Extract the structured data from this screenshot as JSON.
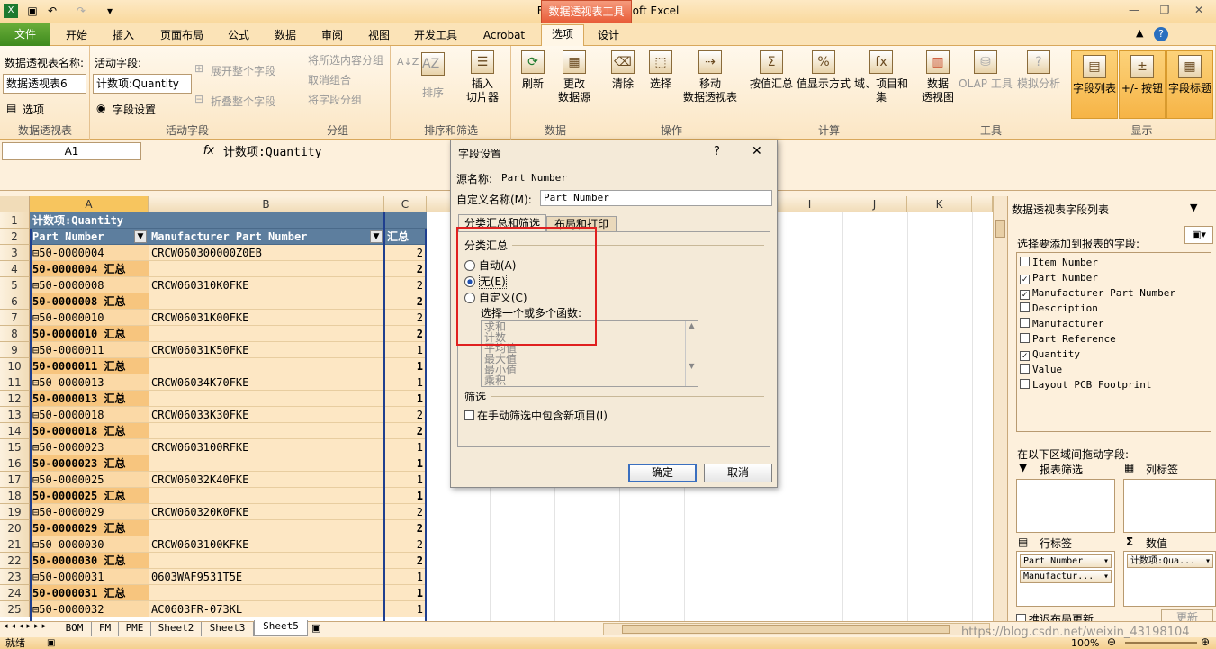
{
  "window": {
    "title": "BOM.xlsx - Microsoft Excel",
    "context_tool": "数据透视表工具"
  },
  "tabs": [
    "文件",
    "开始",
    "插入",
    "页面布局",
    "公式",
    "数据",
    "审阅",
    "视图",
    "开发工具",
    "Acrobat",
    "选项",
    "设计"
  ],
  "ribbon": {
    "pt_name_label": "数据透视表名称:",
    "pt_name_value": "数据透视表6",
    "options_btn": "选项",
    "grp_pt": "数据透视表",
    "active_field_label": "活动字段:",
    "active_field_value": "计数项:Quantity",
    "field_settings": "字段设置",
    "expand_all": "展开整个字段",
    "collapse_all": "折叠整个字段",
    "grp_active": "活动字段",
    "group_sel": "将所选内容分组",
    "ungroup": "取消组合",
    "group_field": "将字段分组",
    "grp_group": "分组",
    "sort": "排序",
    "insert_slicer": "插入\n切片器",
    "grp_sort": "排序和筛选",
    "refresh": "刷新",
    "change_source": "更改\n数据源",
    "grp_data": "数据",
    "clear": "清除",
    "select": "选择",
    "move_pt": "移动\n数据透视表",
    "grp_actions": "操作",
    "summarize_by": "按值汇总",
    "show_values_as": "值显示方式",
    "fields_items": "域、项目和\n集",
    "grp_calc": "计算",
    "pivot_chart": "数据\n透视图",
    "olap": "OLAP 工具",
    "what_if": "模拟分析",
    "grp_tools": "工具",
    "field_list": "字段列表",
    "plus_minus": "+/- 按钮",
    "field_headers": "字段标题",
    "grp_show": "显示"
  },
  "formula_bar": {
    "name_box": "A1",
    "fx": "fx",
    "formula": "计数项:Quantity"
  },
  "columns": [
    "A",
    "B",
    "C",
    "D",
    "E",
    "F",
    "G",
    "H",
    "I",
    "J",
    "K"
  ],
  "rows": [
    {
      "n": "1",
      "a": "计数项:Quantity",
      "b": "",
      "c": "",
      "style": "title"
    },
    {
      "n": "2",
      "a": "Part Number",
      "b": "Manufacturer Part Number",
      "c": "汇总",
      "style": "header"
    },
    {
      "n": "3",
      "a": "⊟50-0000004",
      "b": "CRCW060300000Z0EB",
      "c": "2",
      "style": "item"
    },
    {
      "n": "4",
      "a": "50-0000004 汇总",
      "b": "",
      "c": "2",
      "style": "total"
    },
    {
      "n": "5",
      "a": "⊟50-0000008",
      "b": "CRCW060310K0FKE",
      "c": "2",
      "style": "item"
    },
    {
      "n": "6",
      "a": "50-0000008 汇总",
      "b": "",
      "c": "2",
      "style": "total"
    },
    {
      "n": "7",
      "a": "⊟50-0000010",
      "b": "CRCW06031K00FKE",
      "c": "2",
      "style": "item"
    },
    {
      "n": "8",
      "a": "50-0000010 汇总",
      "b": "",
      "c": "2",
      "style": "total"
    },
    {
      "n": "9",
      "a": "⊟50-0000011",
      "b": "CRCW06031K50FKE",
      "c": "1",
      "style": "item"
    },
    {
      "n": "10",
      "a": "50-0000011 汇总",
      "b": "",
      "c": "1",
      "style": "total"
    },
    {
      "n": "11",
      "a": "⊟50-0000013",
      "b": "CRCW06034K70FKE",
      "c": "1",
      "style": "item"
    },
    {
      "n": "12",
      "a": "50-0000013 汇总",
      "b": "",
      "c": "1",
      "style": "total"
    },
    {
      "n": "13",
      "a": "⊟50-0000018",
      "b": "CRCW06033K30FKE",
      "c": "2",
      "style": "item"
    },
    {
      "n": "14",
      "a": "50-0000018 汇总",
      "b": "",
      "c": "2",
      "style": "total"
    },
    {
      "n": "15",
      "a": "⊟50-0000023",
      "b": "CRCW0603100RFKE",
      "c": "1",
      "style": "item"
    },
    {
      "n": "16",
      "a": "50-0000023 汇总",
      "b": "",
      "c": "1",
      "style": "total"
    },
    {
      "n": "17",
      "a": "⊟50-0000025",
      "b": "CRCW06032K40FKE",
      "c": "1",
      "style": "item"
    },
    {
      "n": "18",
      "a": "50-0000025 汇总",
      "b": "",
      "c": "1",
      "style": "total"
    },
    {
      "n": "19",
      "a": "⊟50-0000029",
      "b": "CRCW060320K0FKE",
      "c": "2",
      "style": "item"
    },
    {
      "n": "20",
      "a": "50-0000029 汇总",
      "b": "",
      "c": "2",
      "style": "total"
    },
    {
      "n": "21",
      "a": "⊟50-0000030",
      "b": "CRCW0603100KFKE",
      "c": "2",
      "style": "item"
    },
    {
      "n": "22",
      "a": "50-0000030 汇总",
      "b": "",
      "c": "2",
      "style": "total"
    },
    {
      "n": "23",
      "a": "⊟50-0000031",
      "b": "0603WAF9531T5E",
      "c": "1",
      "style": "item"
    },
    {
      "n": "24",
      "a": "50-0000031 汇总",
      "b": "",
      "c": "1",
      "style": "total"
    },
    {
      "n": "25",
      "a": "⊟50-0000032",
      "b": "AC0603FR-073KL",
      "c": "1",
      "style": "item"
    }
  ],
  "dialog": {
    "title": "字段设置",
    "help": "?",
    "close": "✕",
    "source_label": "源名称:",
    "source_value": "Part Number",
    "custom_label": "自定义名称(M):",
    "custom_value": "Part Number",
    "tab1": "分类汇总和筛选",
    "tab2": "布局和打印",
    "subtotals": "分类汇总",
    "auto": "自动(A)",
    "none": "无(E)",
    "custom": "自定义(C)",
    "choose_funcs": "选择一个或多个函数:",
    "funcs": [
      "求和",
      "计数",
      "平均值",
      "最大值",
      "最小值",
      "乘积"
    ],
    "filter": "筛选",
    "include_new": "在手动筛选中包含新项目(I)",
    "ok": "确定",
    "cancel": "取消"
  },
  "pane": {
    "title": "数据透视表字段列表",
    "choose": "选择要添加到报表的字段:",
    "fields": [
      {
        "name": "Item Number",
        "checked": false
      },
      {
        "name": "Part Number",
        "checked": true
      },
      {
        "name": "Manufacturer Part Number",
        "checked": true
      },
      {
        "name": "Description",
        "checked": false
      },
      {
        "name": "Manufacturer",
        "checked": false
      },
      {
        "name": "Part Reference",
        "checked": false
      },
      {
        "name": "Quantity",
        "checked": true
      },
      {
        "name": "Value",
        "checked": false
      },
      {
        "name": "Layout PCB Footprint",
        "checked": false
      }
    ],
    "drag_label": "在以下区域间拖动字段:",
    "report_filter": "报表筛选",
    "col_labels": "列标签",
    "row_labels": "行标签",
    "values": "数值",
    "row_items": [
      "Part Number",
      "Manufactur..."
    ],
    "value_items": [
      "计数项:Qua..."
    ],
    "defer": "推迟布局更新",
    "update": "更新"
  },
  "sheets": [
    "BOM",
    "FM",
    "PME",
    "Sheet2",
    "Sheet3",
    "Sheet5"
  ],
  "status": {
    "ready": "就绪",
    "zoom": "100%",
    "watermark": "https://blog.csdn.net/weixin_43198104"
  }
}
